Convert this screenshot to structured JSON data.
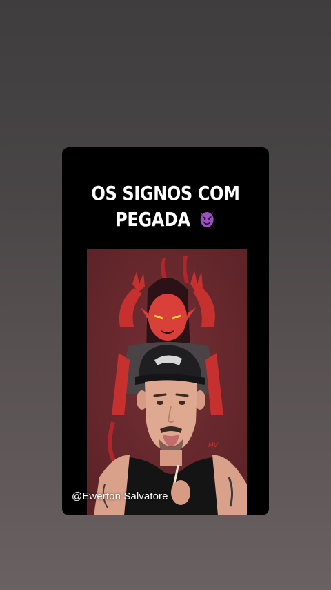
{
  "story": {
    "title_line1": "OS SIGNOS COM",
    "title_line2": "PEGADA",
    "title_emoji": "smiling-devil-emoji",
    "watermark": "@Ewerton Salvatore",
    "video_description_icon": "video-frame"
  },
  "colors": {
    "background_top": "#3f3d3e",
    "background_bottom": "#6a6162",
    "card": "#000000",
    "video_backdrop": "#6b2a2f",
    "emoji_purple": "#8e44ad",
    "title_text": "#ffffff"
  }
}
